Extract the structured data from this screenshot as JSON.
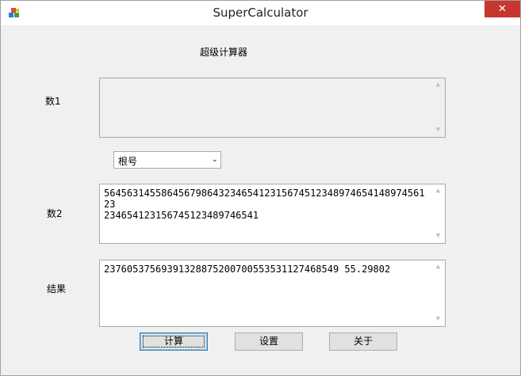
{
  "window": {
    "title": "SuperCalculator",
    "close_glyph": "✕",
    "icon": "app-icon"
  },
  "form": {
    "heading": "超级计算器",
    "label_num1": "数1",
    "label_num2": "数2",
    "label_result": "结果",
    "num1_value": "",
    "operation": {
      "selected": "根号",
      "icon": "chevron-down-icon"
    },
    "num2_value": "5645631455864567986432346541231567451234897465414897456123\n23465412315674512348974654​1",
    "result_value": "23760537569391328875200700553531127468549 55.29802"
  },
  "buttons": {
    "calculate": "计算",
    "settings": "设置",
    "about": "关于"
  },
  "colors": {
    "close_button": "#c7372f",
    "window_bg": "#f0f0f0"
  }
}
